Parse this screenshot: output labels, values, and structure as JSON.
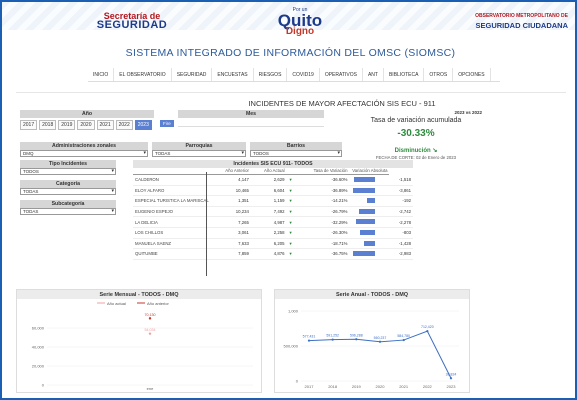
{
  "header": {
    "left_logo": {
      "line1": "Secretaría de",
      "line2": "SEGURIDAD"
    },
    "center_logo": {
      "top": "Por un",
      "line1": "Quito",
      "line2": "Digno"
    },
    "right_logo": {
      "line1": "OBSERVATORIO METROPOLITANO DE",
      "line2": "SEGURIDAD CIUDADANA"
    }
  },
  "system_title": "SISTEMA INTEGRADO DE INFORMACIÓN DEL OMSC (SIOMSC)",
  "nav": [
    "INICIO",
    "EL OBSERVATORIO",
    "SEGURIDAD",
    "ENCUESTAS",
    "RIESGOS",
    "COVID19",
    "OPERATIVOS",
    "ANT",
    "BIBLIOTECA",
    "OTROS",
    "OPCIONES"
  ],
  "dashboard_title": "INCIDENTES DE MAYOR AFECTACIÓN SIS ECU - 911",
  "filters": {
    "anio_label": "Año",
    "years": [
      "2017",
      "2018",
      "2019",
      "2020",
      "2021",
      "2022",
      "2023"
    ],
    "selected_year": "2023",
    "fire_button": "Fire",
    "mes_label": "Mes",
    "adm_label": "Administraciones zonales",
    "adm_value": "DMQ",
    "parroquias_label": "Parroquias",
    "parroquias_value": "TODAS",
    "barrios_label": "Barrios",
    "barrios_value": "TODOS",
    "tipo_label": "Tipo Incidentes",
    "tipo_value": "TODOS",
    "categoria_label": "Categoría",
    "categoria_value": "TODAS",
    "subcategoria_label": "Subcategoría",
    "subcategoria_value": "TODAS"
  },
  "rate": {
    "comparison": "2023 vs 2022",
    "label": "Tasa de variación acumulada",
    "value": "-30.33%",
    "trend": "Disminución",
    "cutoff": "FECHA DE CORTE: 02 de Enero de 2023"
  },
  "table": {
    "title": "Incidentes SIS ECU 911- TODOS",
    "headers": [
      "",
      "Año Anterior",
      "Año Actual",
      "",
      "Tasa de Variación",
      "Variación Absoluta"
    ],
    "rows": [
      {
        "name": "CALDERON",
        "prev": "4,147",
        "curr": "2,629",
        "rate": "-36.60%",
        "abs": "-1,518",
        "pct": 36.6
      },
      {
        "name": "ELOY ALFARO",
        "prev": "10,465",
        "curr": "6,604",
        "rate": "-36.89%",
        "abs": "-3,861",
        "pct": 36.89
      },
      {
        "name": "ESPECIAL TURISTICA LA MARISCAL",
        "prev": "1,351",
        "curr": "1,159",
        "rate": "-14.21%",
        "abs": "-192",
        "pct": 14.21
      },
      {
        "name": "EUGENIO ESPEJO",
        "prev": "10,234",
        "curr": "7,492",
        "rate": "-26.79%",
        "abs": "-2,742",
        "pct": 26.79
      },
      {
        "name": "LA DELICIA",
        "prev": "7,265",
        "curr": "4,987",
        "rate": "-32.29%",
        "abs": "-2,278",
        "pct": 32.29
      },
      {
        "name": "LOS CHILLOS",
        "prev": "3,061",
        "curr": "2,258",
        "rate": "-26.30%",
        "abs": "-803",
        "pct": 26.3
      },
      {
        "name": "MANUELA SAENZ",
        "prev": "7,633",
        "curr": "6,205",
        "rate": "-18.71%",
        "abs": "-1,428",
        "pct": 18.71
      },
      {
        "name": "QUITUMBE",
        "prev": "7,859",
        "curr": "4,876",
        "rate": "-36.75%",
        "abs": "-2,983",
        "pct": 36.75
      }
    ]
  },
  "chart_data": [
    {
      "type": "line",
      "title": "Serie Mensual - TODOS - DMQ",
      "legend": [
        "Año actual",
        "Año anterior"
      ],
      "legend_position": "top",
      "categories": [
        "ene"
      ],
      "series": [
        {
          "name": "Año actual",
          "values": [
            54034
          ],
          "labels": [
            "54,034"
          ],
          "color": "#f0a0a0"
        },
        {
          "name": "Año anterior",
          "values": [
            70130
          ],
          "labels": [
            "70,130"
          ],
          "color": "#c0392b"
        }
      ],
      "y_ticks": [
        "40,000",
        "60,000",
        "20,000",
        "0"
      ],
      "ylim": [
        0,
        80000
      ],
      "grid": true
    },
    {
      "type": "line",
      "title": "Serie Anual - TODOS - DMQ",
      "categories": [
        "2017",
        "2018",
        "2019",
        "2020",
        "2021",
        "2022",
        "2023"
      ],
      "series": [
        {
          "values": [
            577431,
            591252,
            596288,
            560237,
            584780,
            712420,
            38824
          ],
          "labels": [
            "577,431",
            "591,252",
            "596,288",
            "560,237",
            "584,780",
            "712,420",
            "38,824"
          ],
          "color": "#3d6fc4"
        }
      ],
      "y_ticks": [
        "1,000",
        "500,000",
        "0"
      ],
      "ylim": [
        0,
        1000000
      ],
      "grid": true
    }
  ]
}
